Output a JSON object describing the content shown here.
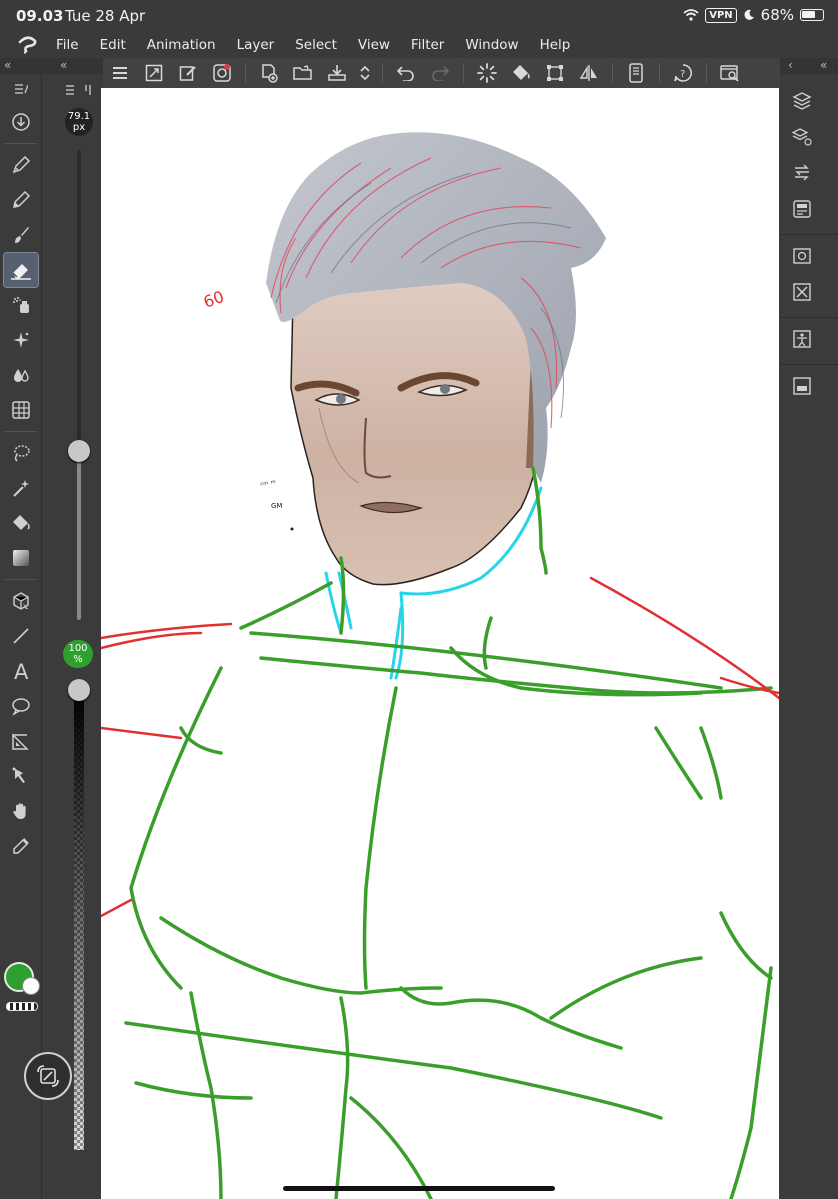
{
  "status": {
    "time": "09.03",
    "date": "Tue 28 Apr",
    "vpn": "VPN",
    "battery": "68%",
    "battery_level": 0.68
  },
  "menu": [
    "File",
    "Edit",
    "Animation",
    "Layer",
    "Select",
    "View",
    "Filter",
    "Window",
    "Help"
  ],
  "toolbar_icons": [
    "menu-icon",
    "canvas-fit-icon",
    "edit-icon",
    "rotate-icon",
    "new-file-icon",
    "open-icon",
    "save-icon",
    "stepper-icon",
    "undo-icon",
    "redo-icon",
    "loading-icon",
    "fill-icon",
    "transform-icon",
    "flip-icon",
    "device-icon",
    "help-icon",
    "settings-icon"
  ],
  "left_tools": [
    "download-icon",
    "pen-icon",
    "pencil-icon",
    "brush-icon",
    "eraser-icon",
    "airbrush-icon",
    "decoration-icon",
    "blend-icon",
    "frame-icon",
    "lasso-icon",
    "magic-wand-icon",
    "fill-icon",
    "gradient-icon",
    "3d-icon",
    "line-icon",
    "text-icon",
    "balloon-icon",
    "ruler-icon",
    "operation-icon",
    "hand-icon",
    "eyedropper-icon"
  ],
  "brush": {
    "size_value": "79.1",
    "size_unit": "px",
    "size_level": 0.36,
    "opacity_value": "100",
    "opacity_unit": "%",
    "opacity_level": 1.0
  },
  "colors": {
    "main": "#2fa030",
    "sub": "#ffffff",
    "active_tool_bg": "#566070",
    "sketch_green": "#3a9e2a",
    "sketch_red": "#e23030",
    "sketch_cyan": "#26d6e8"
  },
  "right_icons": [
    "layers-icon",
    "layer-property-icon",
    "history-icon",
    "navigator-icon",
    "search-icon",
    "material-icon",
    "pose-icon",
    "sub-view-icon"
  ],
  "canvas": {
    "annotation": "60",
    "scribble_1": "ᶜᵐ ᵐ",
    "scribble_2": "GM"
  }
}
